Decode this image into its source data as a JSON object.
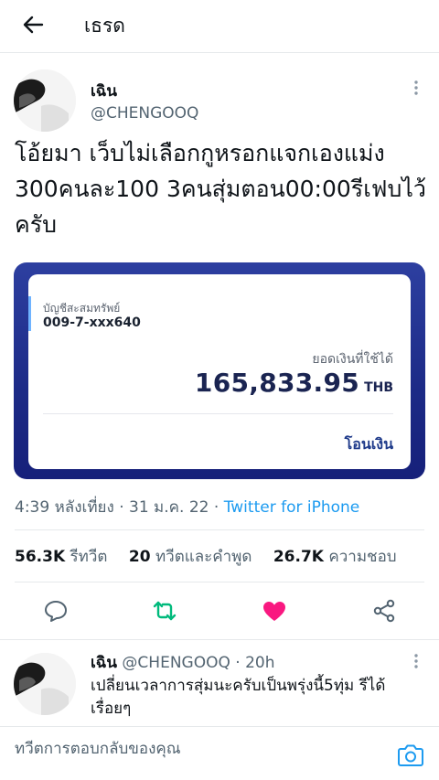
{
  "header": {
    "title": "เธรด",
    "back_icon": "arrow-left-icon"
  },
  "tweet": {
    "author_name": "เฉิน",
    "author_handle": "@CHENGOOQ",
    "text": "โอ้ยมา เว็บไม่เลือกกูหรอกแจกเองแม่ง 300คนละ100 3คนสุ่มตอน00:00รีเฟบไว้ครับ",
    "card": {
      "account_type": "บัญชีสะสมทรัพย์",
      "account_number": "009-7-xxx640",
      "balance_label": "ยอดเงินที่ใช้ได้",
      "balance": "165,833.95",
      "currency": "THB",
      "transfer_label": "โอนเงิน",
      "gradient_top": "#2d3fa0",
      "gradient_bottom": "#16207a"
    },
    "time": "4:39 หลังเที่ยง",
    "date": "31 ม.ค. 22",
    "source": "Twitter for iPhone",
    "stats": {
      "retweets": "56.3K",
      "retweets_label": "รีทวีต",
      "quotes": "20",
      "quotes_label": "ทวีตและคำพูด",
      "likes": "26.7K",
      "likes_label": "ความชอบ"
    },
    "actions": [
      "reply-icon",
      "retweet-icon",
      "like-icon",
      "share-icon"
    ],
    "colors": {
      "retweet": "#00ba7c",
      "like": "#f91880",
      "link": "#1d9bf0"
    }
  },
  "reply": {
    "author_name": "เฉิน",
    "author_handle": "@CHENGOOQ",
    "time": "20h",
    "text": "เปลี่ยนเวลาการสุ่มนะครับเป็นพรุ่งนี้5ทุ่ม รีได้เรื่อยๆ"
  },
  "compose": {
    "placeholder": "ทวีตการตอบกลับของคุณ",
    "camera_icon": "camera-icon"
  }
}
